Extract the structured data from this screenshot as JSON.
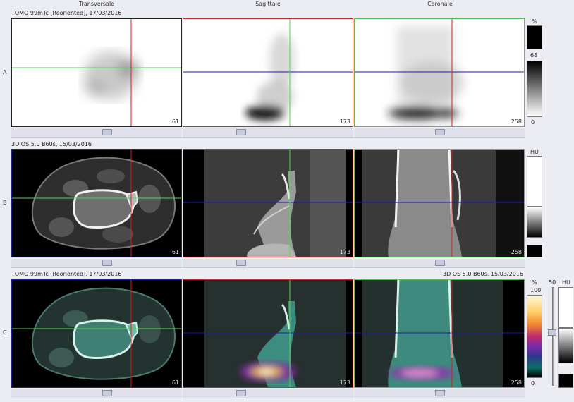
{
  "columns": [
    "Transversale",
    "Sagittale",
    "Coronale"
  ],
  "rows": [
    {
      "label": "A",
      "series": "TOMO 99mTc [Reoriented], 17/03/2016",
      "slices": [
        "61",
        "173",
        "258"
      ]
    },
    {
      "label": "B",
      "series": "3D  OS  5.0  B60s, 15/03/2016",
      "slices": [
        "61",
        "173",
        "258"
      ]
    },
    {
      "label": "C",
      "series_left": "TOMO 99mTc [Reoriented], 17/03/2016",
      "series_right": "3D  OS  5.0  B60s, 15/03/2016",
      "slices": [
        "61",
        "173",
        "258"
      ]
    }
  ],
  "colorbars": {
    "a": {
      "unit": "%",
      "value": "68",
      "min": "0"
    },
    "b": {
      "unit": "HU"
    },
    "c": {
      "unit_pct": "%",
      "max_pct": "100",
      "min_pct": "0",
      "blend": "50",
      "unit_hu": "HU"
    }
  },
  "colors": {
    "crosshair_transversal_h": "#4ed94e",
    "crosshair_red": "#d42020",
    "crosshair_blue": "#1a1ab4",
    "border_transversal": "#22238f",
    "border_sagittal": "#c42828",
    "border_coronal": "#58c058"
  }
}
